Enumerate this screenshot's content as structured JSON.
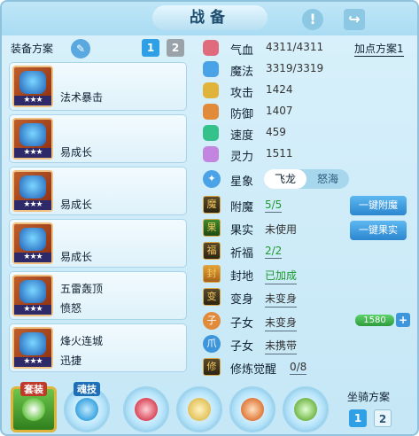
{
  "header": {
    "title": "战备",
    "icons": [
      "exclamation-icon",
      "share-icon"
    ],
    "exclaim": "!",
    "share": "↪"
  },
  "equip_plan": {
    "label": "装备方案",
    "tabs": [
      "1",
      "2"
    ],
    "active_tab": "1"
  },
  "equipment": [
    {
      "lines": [
        "法术暴击"
      ],
      "stars": "★★★"
    },
    {
      "lines": [
        "易成长"
      ],
      "stars": "★★★"
    },
    {
      "lines": [
        "易成长"
      ],
      "stars": "★★★"
    },
    {
      "lines": [
        "易成长"
      ],
      "stars": "★★★"
    },
    {
      "lines": [
        "五雷轰顶",
        "愤怒"
      ],
      "stars": "★★★"
    },
    {
      "lines": [
        "烽火连城",
        "迅捷"
      ],
      "stars": "★★★"
    }
  ],
  "stats": [
    {
      "label": "气血",
      "value": "4311/4311",
      "icon": "heart-icon",
      "color": "#e06b7c"
    },
    {
      "label": "魔法",
      "value": "3319/3319",
      "icon": "diamond-icon",
      "color": "#4aa3e6"
    },
    {
      "label": "攻击",
      "value": "1424",
      "icon": "sword-icon",
      "color": "#e0b43a"
    },
    {
      "label": "防御",
      "value": "1407",
      "icon": "shield-icon",
      "color": "#e08a3a"
    },
    {
      "label": "速度",
      "value": "459",
      "icon": "speed-icon",
      "color": "#34c28a"
    },
    {
      "label": "灵力",
      "value": "1511",
      "icon": "spirit-icon",
      "color": "#c485e0"
    }
  ],
  "add_points": {
    "label": "加点方案1"
  },
  "constellation": {
    "label": "星象",
    "options": [
      "飞龙",
      "怒海"
    ],
    "selected": "飞龙"
  },
  "traits": [
    {
      "label": "附魔",
      "value": "5/5",
      "value_color": "#1e9a2e",
      "icon": "enchant-icon",
      "glyph": "魔"
    },
    {
      "label": "果实",
      "value": "未使用",
      "value_color": "#444444",
      "icon": "fruit-icon",
      "glyph": "果"
    },
    {
      "label": "祈福",
      "value": "2/2",
      "value_color": "#1e9a2e",
      "icon": "pray-icon",
      "glyph": "福"
    },
    {
      "label": "封地",
      "value": "已加成",
      "value_color": "#1e9a2e",
      "icon": "fief-icon",
      "glyph": "封"
    },
    {
      "label": "变身",
      "value": "未变身",
      "value_color": "#444444",
      "icon": "transform-icon",
      "glyph": "变"
    },
    {
      "label": "子女",
      "value": "未变身",
      "value_color": "#444444",
      "icon": "child-icon",
      "glyph": "子"
    },
    {
      "label": "子女",
      "value": "未携带",
      "value_color": "#444444",
      "icon": "paw-icon",
      "glyph": "爪"
    },
    {
      "label": "修炼觉醒",
      "value": "0/8",
      "value_color": "#444444",
      "icon": "cultivate-icon",
      "glyph": "修"
    }
  ],
  "actions": {
    "enchant": "一键附魔",
    "fruit": "一键果实"
  },
  "child_bar": {
    "value": "1580",
    "fill_fraction": 1.0,
    "plus": "+"
  },
  "bottom_slots": [
    {
      "name": "suit",
      "label": "套装",
      "color": "#5fb53a"
    },
    {
      "name": "skill",
      "label": "魂技",
      "color": "#3ba4e0"
    },
    {
      "name": "slot-3",
      "label": "",
      "color": "#d9485b"
    },
    {
      "name": "slot-4",
      "label": "",
      "color": "#e2c15a"
    },
    {
      "name": "slot-5",
      "label": "",
      "color": "#e0793a"
    },
    {
      "name": "slot-6",
      "label": "",
      "color": "#73b84a"
    }
  ],
  "mount": {
    "label": "坐骑方案",
    "tabs": [
      "1",
      "2"
    ],
    "active_tab": "1"
  }
}
